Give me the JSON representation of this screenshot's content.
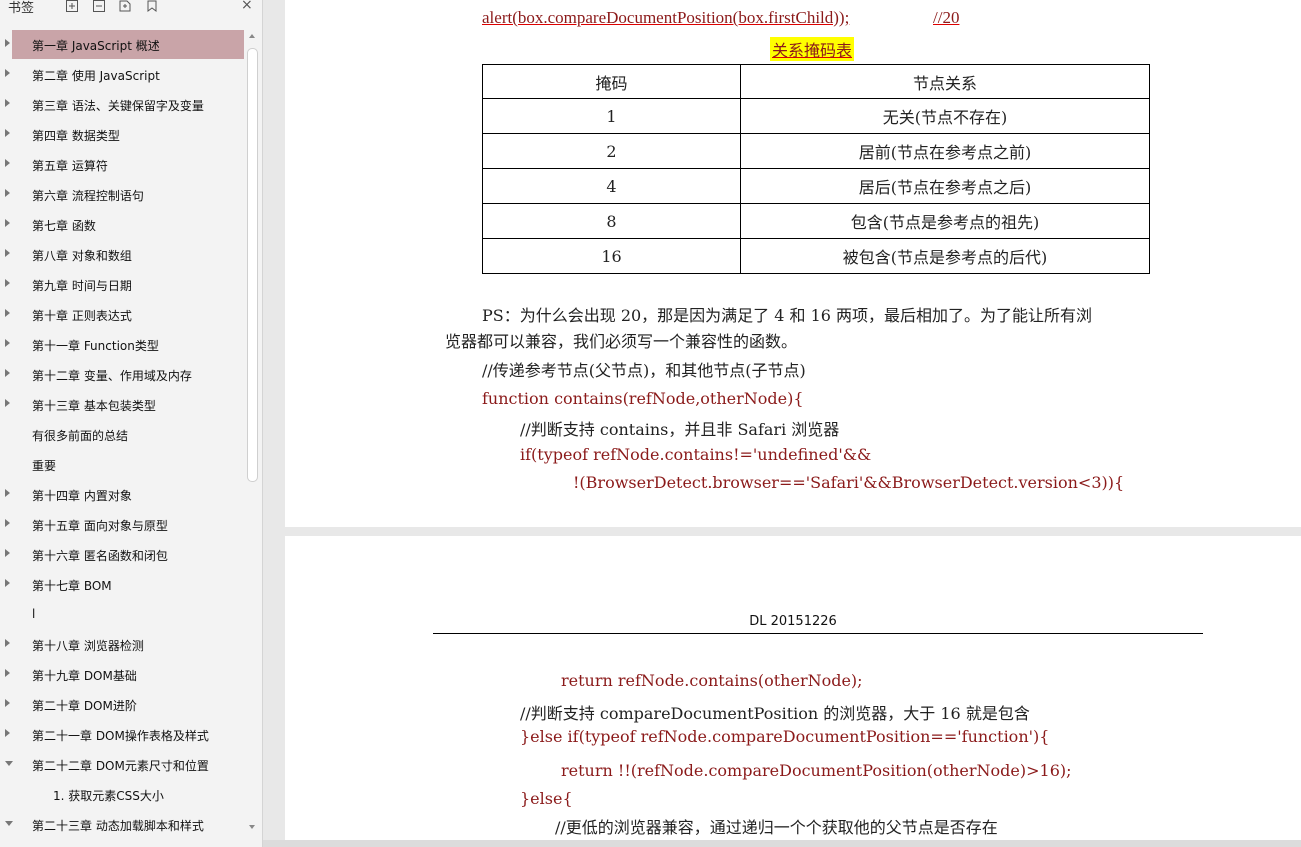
{
  "sidebar": {
    "title": "书签",
    "toolbar_icons": [
      "expand-all-icon",
      "collapse-all-icon",
      "add-bookmark-icon",
      "bookmark-options-icon"
    ],
    "close_glyph": "×",
    "items": [
      {
        "label": "第一章   JavaScript 概述",
        "arrow": "collapsed",
        "selected": true
      },
      {
        "label": "第二章  使用 JavaScript",
        "arrow": "collapsed"
      },
      {
        "label": "第三章  语法、关键保留字及变量",
        "arrow": "collapsed"
      },
      {
        "label": "第四章  数据类型",
        "arrow": "collapsed"
      },
      {
        "label": "第五章  运算符",
        "arrow": "collapsed"
      },
      {
        "label": "第六章  流程控制语句",
        "arrow": "collapsed"
      },
      {
        "label": "第七章  函数",
        "arrow": "collapsed"
      },
      {
        "label": "第八章  对象和数组",
        "arrow": "collapsed"
      },
      {
        "label": "第九章  时间与日期",
        "arrow": "collapsed"
      },
      {
        "label": "第十章  正则表达式",
        "arrow": "collapsed"
      },
      {
        "label": "第十一章  Function类型",
        "arrow": "collapsed"
      },
      {
        "label": "第十二章  变量、作用域及内存",
        "arrow": "collapsed"
      },
      {
        "label": "第十三章  基本包装类型",
        "arrow": "collapsed"
      },
      {
        "label": "有很多前面的总结",
        "arrow": "none"
      },
      {
        "label": "重要",
        "arrow": "none"
      },
      {
        "label": "第十四章  内置对象",
        "arrow": "collapsed"
      },
      {
        "label": "第十五章  面向对象与原型",
        "arrow": "collapsed"
      },
      {
        "label": "第十六章  匿名函数和闭包",
        "arrow": "collapsed"
      },
      {
        "label": "第十七章  BOM",
        "arrow": "collapsed"
      },
      {
        "label": "l",
        "arrow": "none"
      },
      {
        "label": "第十八章  浏览器检测",
        "arrow": "collapsed"
      },
      {
        "label": "第十九章  DOM基础",
        "arrow": "collapsed"
      },
      {
        "label": "第二十章  DOM进阶",
        "arrow": "collapsed"
      },
      {
        "label": "第二十一章  DOM操作表格及样式",
        "arrow": "collapsed"
      },
      {
        "label": "第二十二章  DOM元素尺寸和位置",
        "arrow": "expanded"
      },
      {
        "label": "1. 获取元素CSS大小",
        "arrow": "none",
        "sub": true
      },
      {
        "label": "第二十三章  动态加载脚本和样式",
        "arrow": "expanded"
      }
    ]
  },
  "page1": {
    "alert_line": "alert(box.compareDocumentPosition(box.firstChild));",
    "alert_comment": "//20",
    "mask_title": "关系掩码表",
    "table": {
      "headers": [
        "掩码",
        "节点关系"
      ],
      "rows": [
        [
          "1",
          "无关(节点不存在)"
        ],
        [
          "2",
          "居前(节点在参考点之前)"
        ],
        [
          "4",
          "居后(节点在参考点之后)"
        ],
        [
          "8",
          "包含(节点是参考点的祖先)"
        ],
        [
          "16",
          "被包含(节点是参考点的后代)"
        ]
      ]
    },
    "ps_line1": "PS：为什么会出现 20，那是因为满足了 4 和 16 两项，最后相加了。为了能让所有浏",
    "ps_line2": "览器都可以兼容，我们必须写一个兼容性的函数。",
    "comment1": "//传递参考节点(父节点)，和其他节点(子节点)",
    "func_decl": "function contains(refNode,otherNode){",
    "comment2": "//判断支持 contains，并且非 Safari 浏览器",
    "if_line": "if(typeof  refNode.contains!='undefined'&&",
    "if_cont": "!(BrowserDetect.browser=='Safari'&&BrowserDetect.version<3)){"
  },
  "page2": {
    "header": "DL 20151226",
    "return1": "return refNode.contains(otherNode);",
    "comment3": "//判断支持 compareDocumentPosition 的浏览器，大于 16 就是包含",
    "elseif_line": "}else if(typeof  refNode.compareDocumentPosition=='function'){",
    "return2": "return !!(refNode.compareDocumentPosition(otherNode)>16);",
    "else_line": "}else{",
    "comment4": "//更低的浏览器兼容，通过递归一个个获取他的父节点是否存在"
  }
}
